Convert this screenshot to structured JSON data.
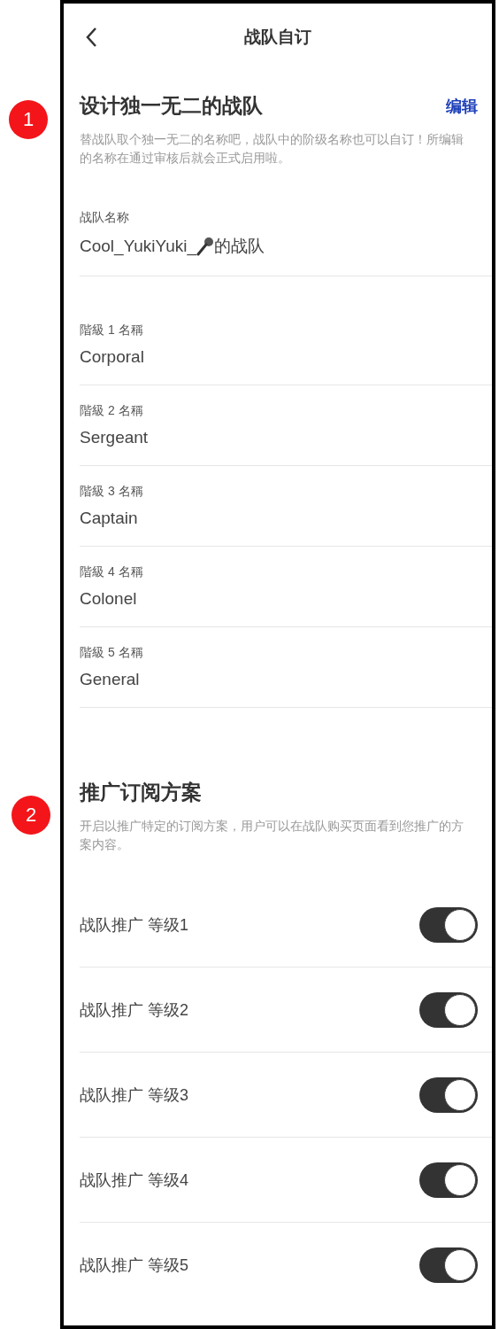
{
  "header": {
    "title": "战队自订"
  },
  "annotations": [
    "1",
    "2"
  ],
  "design_section": {
    "title": "设计独一无二的战队",
    "edit_link": "编辑",
    "description": "替战队取个独一无二的名称吧，战队中的阶级名称也可以自订！所编辑的名称在通过审核后就会正式启用啦。",
    "team_name": {
      "label": "战队名称",
      "value_start": "Cool_YukiYuki_",
      "value_end": "的战队"
    },
    "ranks": [
      {
        "label": "階級 1 名稱",
        "value": "Corporal"
      },
      {
        "label": "階級 2 名稱",
        "value": "Sergeant"
      },
      {
        "label": "階級 3 名稱",
        "value": "Captain"
      },
      {
        "label": "階級 4 名稱",
        "value": "Colonel"
      },
      {
        "label": "階級 5 名稱",
        "value": "General"
      }
    ]
  },
  "promo_section": {
    "title": "推广订阅方案",
    "description": "开启以推广特定的订阅方案，用户可以在战队购买页面看到您推广的方案内容。",
    "tiers": [
      {
        "label": "战队推广 等级1",
        "on": true
      },
      {
        "label": "战队推广 等级2",
        "on": true
      },
      {
        "label": "战队推广 等级3",
        "on": true
      },
      {
        "label": "战队推广 等级4",
        "on": true
      },
      {
        "label": "战队推广 等级5",
        "on": true
      }
    ]
  }
}
